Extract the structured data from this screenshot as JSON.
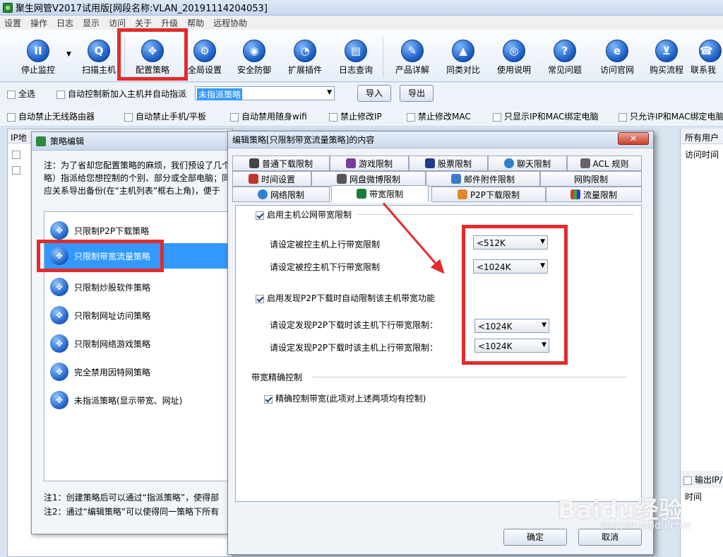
{
  "window": {
    "title": "聚生网管V2017试用版[网段名称:VLAN_20191114204053]"
  },
  "menu": [
    "设置",
    "操作",
    "日志",
    "显示",
    "访问",
    "关于",
    "升级",
    "帮助",
    "远程协助"
  ],
  "toolbar": [
    {
      "label": "停止监控",
      "icon": "pause-icon"
    },
    {
      "label": "扫描主机",
      "icon": "scan-icon"
    },
    {
      "label": "配置策略",
      "icon": "move-icon"
    },
    {
      "label": "全局设置",
      "icon": "gear-icon"
    },
    {
      "label": "安全防御",
      "icon": "shield-icon"
    },
    {
      "label": "扩展插件",
      "icon": "plugin-icon"
    },
    {
      "label": "日志查询",
      "icon": "log-icon"
    },
    {
      "label": "产品详解",
      "icon": "product-icon"
    },
    {
      "label": "同类对比",
      "icon": "compare-icon"
    },
    {
      "label": "使用说明",
      "icon": "manual-icon"
    },
    {
      "label": "常见问题",
      "icon": "question-icon"
    },
    {
      "label": "访问官网",
      "icon": "ie-icon"
    },
    {
      "label": "购买流程",
      "icon": "cart-icon"
    },
    {
      "label": "联系我",
      "icon": "contact-icon"
    }
  ],
  "options1": {
    "select_all": "全选",
    "auto_control": "自动控制新加入主机并自动指派",
    "policy_value": "未指派策略",
    "import": "导入",
    "export": "导出"
  },
  "options2": [
    "自动禁止无线路由器",
    "自动禁止手机/平板",
    "自动禁用随身wifi",
    "禁止修改IP",
    "禁止修改MAC",
    "只显示IP和MAC绑定电脑",
    "只允许IP和MAC绑定电脑"
  ],
  "left": {
    "ip_header": "IP地"
  },
  "right": {
    "all_users": "所有用户",
    "visit_time": "访问时间",
    "output_ip": "输出IP/",
    "time": "时间"
  },
  "policy_dialog": {
    "title": "策略编辑",
    "note_lines": [
      "注：为了省却您配置策略的麻烦，我们预设了几个",
      "略）指派给您想控制的个别、部分或全部电脑；同",
      "应关系导出备份(在“主机列表”框右上角)，便于"
    ],
    "items": [
      "只限制P2P下载策略",
      "只限制带宽流量策略",
      "只限制炒股软件策略",
      "只限制网址访问策略",
      "只限制网络游戏策略",
      "完全禁用因特网策略",
      "未指派策略(显示带宽、网址)"
    ],
    "bottom_notes": [
      "注1：创建策略后可以通过“指派策略”，使得部",
      "注2：通过“编辑策略”可以使得同一策略下所有"
    ]
  },
  "edit_dialog": {
    "title": "编辑策略[只限制带宽流量策略]的内容",
    "tabs_row1": [
      "普通下载限制",
      "游戏限制",
      "股票限制",
      "聊天限制",
      "ACL 规则"
    ],
    "tabs_row2": [
      "时间设置",
      "网盘微博限制",
      "邮件附件限制",
      "网购限制"
    ],
    "tabs_row3": [
      "网络限制",
      "带宽限制",
      "P2P下载限制",
      "流量限制"
    ],
    "enable_public": "启用主机公网带宽限制",
    "upload_label": "请设定被控主机上行带宽限制",
    "upload_value": "<512K",
    "download_label": "请设定被控主机下行带宽限制",
    "download_value": "<1024K",
    "enable_p2p": "启用发现P2P下载时自动限制该主机带宽功能",
    "p2p_down_label": "请设定发现P2P下载时该主机下行带宽限制：",
    "p2p_down_value": "<1024K",
    "p2p_up_label": "请设定发现P2P下载时该主机上行带宽限制：",
    "p2p_up_value": "<1024K",
    "precise_group": "带宽精确控制",
    "precise_label": "精确控制带宽(此项对上述两项均有控制)",
    "ok": "确定",
    "cancel": "取消"
  },
  "watermark": {
    "text": "Baidu经验",
    "sub": "jingyan.baidu.com"
  }
}
